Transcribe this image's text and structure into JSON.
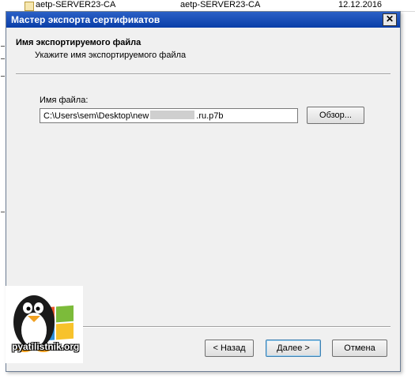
{
  "background": {
    "row_text_1": "aetp-SERVER23-CA",
    "row_text_2": "aetp-SERVER23-CA",
    "row_date": "12.12.2016"
  },
  "dialog": {
    "title": "Мастер экспорта сертификатов",
    "close_label": "✕",
    "header_title": "Имя экспортируемого файла",
    "header_subtitle": "Укажите имя экспортируемого файла",
    "file_label": "Имя файла:",
    "file_path_start": "C:\\Users\\sem\\Desktop\\new",
    "file_path_end": ".ru.p7b",
    "browse_label": "Обзор...",
    "back_label": "< Назад",
    "next_label": "Далее >",
    "cancel_label": "Отмена"
  },
  "watermark": {
    "text": "pyatilistnik.org"
  },
  "colors": {
    "titlebar": "#0a3ea8",
    "dialog_bg": "#f0f0f0",
    "default_button_border": "#3c7fb1"
  }
}
